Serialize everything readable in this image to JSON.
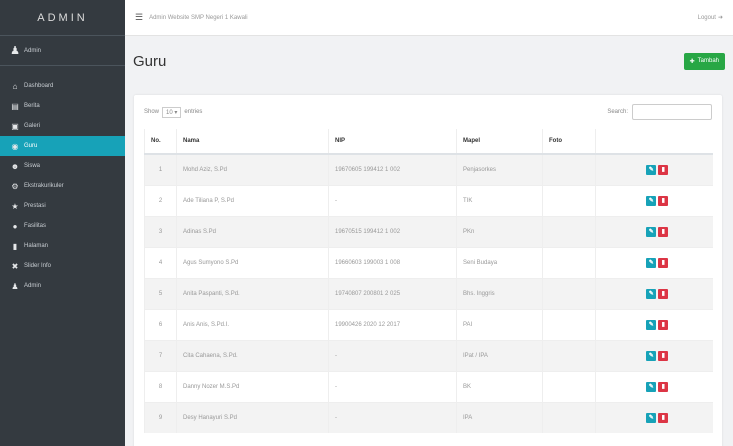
{
  "sidebar": {
    "brand": "ADMIN",
    "user": {
      "label": "Admin",
      "icon": "user-icon"
    },
    "items": [
      {
        "label": "Dashboard",
        "icon": "home-icon"
      },
      {
        "label": "Berita",
        "icon": "news-icon"
      },
      {
        "label": "Galeri",
        "icon": "image-icon"
      },
      {
        "label": "Guru",
        "icon": "teacher-icon",
        "active": true
      },
      {
        "label": "Siswa",
        "icon": "users-icon"
      },
      {
        "label": "Ekstrakurikuler",
        "icon": "gear-icon"
      },
      {
        "label": "Prestasi",
        "icon": "trophy-icon"
      },
      {
        "label": "Fasilitas",
        "icon": "building-icon"
      },
      {
        "label": "Halaman",
        "icon": "file-icon"
      },
      {
        "label": "Slider Info",
        "icon": "sliders-icon"
      },
      {
        "label": "Admin",
        "icon": "admin-icon"
      }
    ]
  },
  "topbar": {
    "title": "Admin Website SMP Negeri 1 Kawali",
    "logout": "Logout"
  },
  "page": {
    "title": "Guru",
    "add_button": "Tambah"
  },
  "table_controls": {
    "show_label": "Show",
    "entries_value": "10",
    "entries_label": "entries",
    "search_label": "Search:"
  },
  "table": {
    "headers": [
      "No.",
      "Nama",
      "NIP",
      "Mapel",
      "Foto",
      ""
    ],
    "rows": [
      {
        "no": "1",
        "nama": "Mohd Aziz, S.Pd",
        "nip": "19670605 199412 1 002",
        "mapel": "Penjasorkes"
      },
      {
        "no": "2",
        "nama": "Ade Tiliana P, S.Pd",
        "nip": "-",
        "mapel": "TIK"
      },
      {
        "no": "3",
        "nama": "Adinas S.Pd",
        "nip": "19670515 199412 1 002",
        "mapel": "PKn"
      },
      {
        "no": "4",
        "nama": "Agus Sumyono S.Pd",
        "nip": "19660603 199003 1 008",
        "mapel": "Seni Budaya"
      },
      {
        "no": "5",
        "nama": "Anita Paspanti, S.Pd.",
        "nip": "19740807 200801 2 025",
        "mapel": "Bhs. Inggris"
      },
      {
        "no": "6",
        "nama": "Anis Anis, S.Pd.I.",
        "nip": "19900426 2020 12 2017",
        "mapel": "PAI"
      },
      {
        "no": "7",
        "nama": "Cita Cahaena, S.Pd.",
        "nip": "-",
        "mapel": "IPat / IPA"
      },
      {
        "no": "8",
        "nama": "Danny Nozer M.S.Pd",
        "nip": "-",
        "mapel": "BK"
      },
      {
        "no": "9",
        "nama": "Desy Hanayuri S.Pd",
        "nip": "-",
        "mapel": "IPA"
      }
    ]
  }
}
